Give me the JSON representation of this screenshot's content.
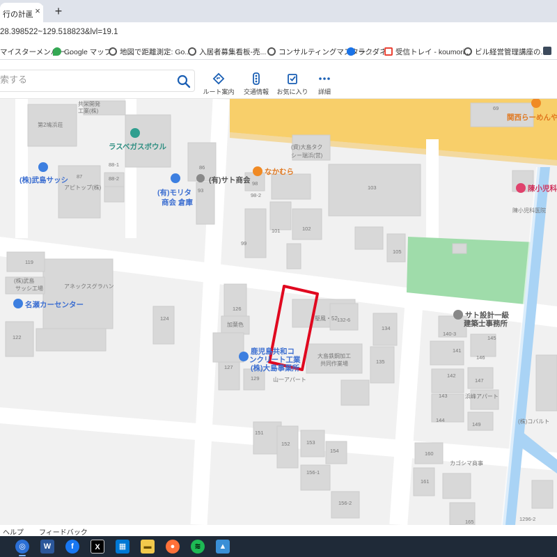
{
  "browser": {
    "tab_title": "行の計画.",
    "tab_close": "×",
    "new_tab": "+",
    "url": "28.398522~129.518823&lvl=19.1"
  },
  "bookmarks": [
    {
      "label": "マイスターメンバー...",
      "icon": "bookmark-icon",
      "color": "#4285f4"
    },
    {
      "label": "Google マップ",
      "icon": "maps-pin-icon",
      "color": "#34a853"
    },
    {
      "label": "地図で距離測定: Go...",
      "icon": "globe-icon",
      "color": "#555555"
    },
    {
      "label": "入居者募集看板-売...",
      "icon": "globe-icon",
      "color": "#555555"
    },
    {
      "label": "コンサルティングマスター...",
      "icon": "globe-icon",
      "color": "#555555"
    },
    {
      "label": "ラクダネ",
      "icon": "cloud-icon",
      "color": "#1a73e8"
    },
    {
      "label": "受信トレイ - koumori...",
      "icon": "gmail-icon",
      "color": "#ea4335"
    },
    {
      "label": "ビル経営管理講座の...",
      "icon": "globe-icon",
      "color": "#555555"
    }
  ],
  "map_header": {
    "search_placeholder": "索する",
    "buttons": [
      {
        "label": "ルート案内",
        "icon": "route-icon"
      },
      {
        "label": "交通情報",
        "icon": "traffic-icon"
      },
      {
        "label": "お気に入り",
        "icon": "favorites-icon"
      },
      {
        "label": "詳細",
        "icon": "more-icon"
      }
    ]
  },
  "map": {
    "poi": {
      "las_vegas_bowl": "ラスベガスボウル",
      "takeshima_sash": "(株)武島サッシ",
      "nakamura": "なかむら",
      "sato_shokai": "(有)サト商会",
      "morita_1": "(有)モリタ",
      "morita_2": "商会 倉庫",
      "naze_car": "名瀬カーセンター",
      "kagoshima_1": "鹿児島共和コ",
      "kagoshima_2": "ンクリート工業",
      "kagoshima_3": "(株)大島事業所",
      "sato_sekkei_1": "サト設計一級",
      "sato_sekkei_2": "建築士事務所",
      "kansai_ramen": "関西らーめんや",
      "clinic": "陳小児科",
      "clinic_sub": "陳小児科医院"
    },
    "labels": {
      "kyoei_1": "共栄開発",
      "kyoei_2": "工業(株)",
      "dai2": "第2鳩浜荘",
      "taxi_1": "(資)大島タク",
      "taxi_2": "シー瑞浜(営)",
      "apitop": "アピトップ(株)",
      "takeshima_factory_1": "(株)武島",
      "takeshima_factory_2": "サッシ工場",
      "annex": "アネックスグラハン",
      "kaminaka": "加葉色",
      "oshima_1": "大島鉄鋼加工",
      "oshima_2": "共同作業場",
      "yama_apt": "山一アパート",
      "hamamine_apt": "浜峰アパート",
      "kagoshima_dormitory": "カゴシマ商事",
      "cobalt": "(株)コバルト",
      "kakeru_52": "駆風・52"
    },
    "numbers": {
      "n69": "69",
      "n86": "86",
      "n87": "87",
      "n88_1": "88-1",
      "n88_2": "88-2",
      "n93": "93",
      "n98": "98",
      "n98_2": "98-2",
      "n99": "99",
      "n101": "101",
      "n102": "102",
      "n103": "103",
      "n105": "105",
      "n119": "119",
      "n122": "122",
      "n124": "124",
      "n126": "126",
      "n127": "127",
      "n129": "129",
      "n132_6": "132-6",
      "n134": "134",
      "n135": "135",
      "n140_3": "140-3",
      "n141": "141",
      "n142": "142",
      "n143": "143",
      "n144": "144",
      "n145": "145",
      "n146": "146",
      "n147": "147",
      "n149": "149",
      "n151": "151",
      "n152": "152",
      "n153": "153",
      "n154": "154",
      "n156_1": "156-1",
      "n156_2": "156-2",
      "n160": "160",
      "n161": "161",
      "n165": "165",
      "n1296_2": "1296-2"
    }
  },
  "footer": {
    "help": "ヘルプ",
    "feedback": "フィードバック"
  },
  "taskbar": [
    {
      "icon": "chrome-icon",
      "color": "#2b6fd6",
      "glyph": "◎"
    },
    {
      "icon": "word-icon",
      "color": "#2b579a",
      "glyph": "W"
    },
    {
      "icon": "facebook-icon",
      "color": "#1877f2",
      "glyph": "f"
    },
    {
      "icon": "x-icon",
      "color": "#000000",
      "glyph": "X"
    },
    {
      "icon": "windows-store-icon",
      "color": "#0078d4",
      "glyph": "▦"
    },
    {
      "icon": "file-explorer-icon",
      "color": "#f2c94c",
      "glyph": "▬"
    },
    {
      "icon": "firefox-icon",
      "color": "#ff7139",
      "glyph": "●"
    },
    {
      "icon": "spotify-icon",
      "color": "#1db954",
      "glyph": "≋"
    },
    {
      "icon": "photos-icon",
      "color": "#3a8fd6",
      "glyph": "▲"
    }
  ]
}
